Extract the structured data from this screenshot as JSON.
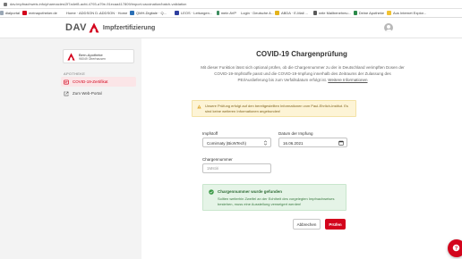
{
  "browser": {
    "url": "dav.impfnachweis.info/pharmacies/2f7a4ef8-acfd-4793-a79e-91ecaa417809/import-vaccination/batch-validation",
    "bookmarks": [
      {
        "label": "dialportal",
        "color": "#9aa7b5"
      },
      {
        "label": "meinapotheker.de",
        "color": "#d3041c"
      },
      {
        "label": "Home · ADDSON D...",
        "color": "#6a6a6a"
      },
      {
        "label": "ADDSON · Home",
        "color": "#4b8a3b"
      },
      {
        "label": "QMH-Digitale · Q...",
        "color": "#2a6fb5"
      },
      {
        "label": "LEOS · Leitungen...",
        "color": "#2f3f9f"
      },
      {
        "label": "mein AVP",
        "color": "#3c8d5f"
      },
      {
        "label": "Login · Deutsche A...",
        "color": "#555555"
      },
      {
        "label": "ABDA · E-Mail ...",
        "color": "#e3b31c"
      },
      {
        "label": "nele Mailbenehmu...",
        "color": "#5a5a5a"
      },
      {
        "label": "Deine Apotheke",
        "color": "#2c8a4a"
      },
      {
        "label": "Aus Internet Explor...",
        "color": "#f1c232"
      }
    ]
  },
  "header": {
    "brand": "DAV",
    "title": "Impfzertifizierung"
  },
  "sidebar": {
    "pharmacy_name": "Bern-Apotheke",
    "pharmacy_city": "96049 Oberhausen",
    "section_label": "APOTHEKE",
    "items": [
      {
        "label": "COVID-19-Zertifikat"
      },
      {
        "label": "Zum Web-Portal"
      }
    ]
  },
  "main": {
    "title": "COVID-19 Chargenprüfung",
    "intro_text": "Mit dieser Funktion lässt sich optional prüfen, ob die Chargennummer zu der in Deutschland verimpften Dosen der COVID-19-Impfstoffe passt und die COVID-19-Impfung innerhalb des Zeitraums der Zulassung des PEI/Auslieferung bis zum Verfallsdatum erfolgt ist.",
    "intro_link": "Weitere Informationen",
    "warning_text": "Unsere Prüfung erfolgt auf den bereitgestellten Informationen vom Paul-Ehrlich-Institut. Es sind keine weiteren Informationen angebunden!",
    "vaccine_label": "Impfstoff",
    "vaccine_value": "Comirnaty (BioNTech)",
    "date_label": "Datum der Impfung",
    "date_value": "16.06.2021",
    "batch_label": "Chargennummer",
    "batch_value": "",
    "batch_placeholder": "1Mstiri",
    "success_title": "Chargennummer wurde gefunden",
    "success_text": "Sollten weiterhin Zweifel an der Echtheit des vorgelegten Impfnachweises bestehen, muss eine Ausstellung verweigert werden!",
    "cancel_label": "Abbrechen",
    "check_label": "Prüfen"
  },
  "colors": {
    "brand_red": "#d3041c",
    "warning_bg": "#fdf4d6",
    "success_bg": "#e5f4e7"
  },
  "icons": {
    "brand_logo": "apotheke-a-icon",
    "avatar": "user-avatar-icon",
    "covid_item": "certificate-icon",
    "web_item": "external-link-icon",
    "warning": "warning-icon",
    "success": "check-circle-icon",
    "select": "sort-arrows-icon",
    "date": "calendar-icon",
    "fab": "help-chat-icon"
  }
}
